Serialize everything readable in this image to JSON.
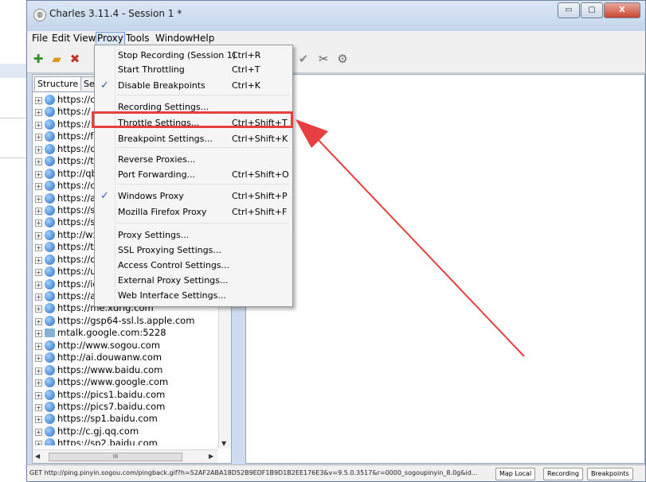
{
  "window": {
    "title": "Charles 3.11.4 - Session 1 *",
    "app_icon": "charles-app-icon",
    "minimize_label": "▭",
    "maximize_label": "▢",
    "close_label": "X"
  },
  "menubar": {
    "file": "File",
    "edit": "Edit",
    "view": "View",
    "proxy": "Proxy",
    "tools": "Tools",
    "window": "Window",
    "help": "Help"
  },
  "toolbar": {
    "icons": [
      "new-session-icon",
      "open-session-icon",
      "clear-session-icon",
      "validate-icon",
      "tools-icon",
      "settings-icon"
    ]
  },
  "left_panel": {
    "tabs": {
      "structure": "Structure",
      "sequence": "Seq"
    },
    "hosts": [
      "https://c",
      "https://",
      "https://",
      "https://fc",
      "https://c",
      "https://tj",
      "http://qb",
      "https://c",
      "https://a",
      "https://s",
      "https://s",
      "http://wx",
      "https://te",
      "https://d",
      "https://u",
      "https://ic",
      "https://a",
      "https://me.xdrig.com",
      "https://gsp64-ssl.ls.apple.com",
      "mtalk.google.com:5228",
      "http://www.sogou.com",
      "http://ai.douwanw.com",
      "https://www.baidu.com",
      "https://www.google.com",
      "https://pics1.baidu.com",
      "https://pics7.baidu.com",
      "https://sp1.baidu.com",
      "http://c.gj.qq.com",
      "https://sp2.baidu.com"
    ],
    "scroll_thumb_label": "III"
  },
  "proxy_menu": [
    {
      "label": "Stop Recording (Session 1)",
      "shortcut": "Ctrl+R",
      "checked": false
    },
    {
      "label": "Start Throttling",
      "shortcut": "Ctrl+T",
      "checked": false
    },
    {
      "label": "Disable Breakpoints",
      "shortcut": "Ctrl+K",
      "checked": true
    },
    {
      "label": "Recording Settings...",
      "shortcut": "",
      "checked": false
    },
    {
      "label": "Throttle Settings...",
      "shortcut": "Ctrl+Shift+T",
      "checked": false
    },
    {
      "label": "Breakpoint Settings...",
      "shortcut": "Ctrl+Shift+K",
      "checked": false
    },
    {
      "label": "Reverse Proxies...",
      "shortcut": "",
      "checked": false
    },
    {
      "label": "Port Forwarding...",
      "shortcut": "Ctrl+Shift+O",
      "checked": false
    },
    {
      "label": "Windows Proxy",
      "shortcut": "Ctrl+Shift+P",
      "checked": true
    },
    {
      "label": "Mozilla Firefox Proxy",
      "shortcut": "Ctrl+Shift+F",
      "checked": false
    },
    {
      "label": "Proxy Settings...",
      "shortcut": "",
      "checked": false
    },
    {
      "label": "SSL Proxying Settings...",
      "shortcut": "",
      "checked": false
    },
    {
      "label": "Access Control Settings...",
      "shortcut": "",
      "checked": false
    },
    {
      "label": "External Proxy Settings...",
      "shortcut": "",
      "checked": false
    },
    {
      "label": "Web Interface Settings...",
      "shortcut": "",
      "checked": false
    }
  ],
  "checkmark": "✓",
  "statusbar": {
    "text": "GET http://ping.pinyin.sogou.com/pingback.gif?h=52AF2ABA18D52B9EDF1B9D1B2EE176E3&v=9.5.0.3517&r=0000_sogoupinyin_8.0g&id...",
    "map_local": "Map Local",
    "recording": "Recording",
    "breakpoints": "Breakpoints"
  },
  "annotation_color": "#e63f3f"
}
